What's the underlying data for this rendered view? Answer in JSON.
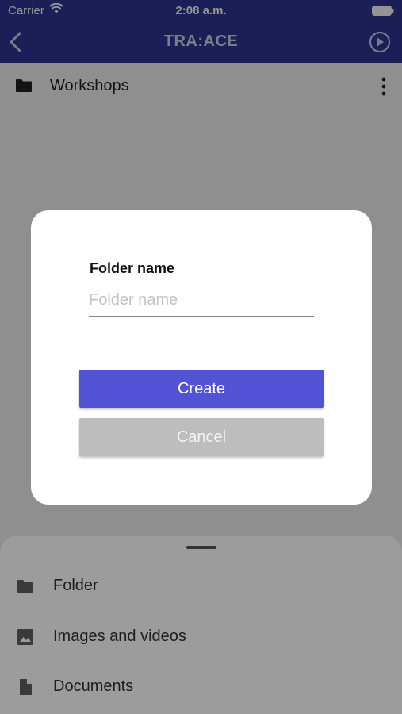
{
  "status_bar": {
    "carrier": "Carrier",
    "time": "2:08 a.m."
  },
  "nav": {
    "title": "TRA:ACE",
    "back_icon": "chevron-left-icon",
    "play_icon": "play-circle-icon"
  },
  "list": {
    "items": [
      {
        "label": "Workshops",
        "icon": "folder-icon"
      }
    ]
  },
  "dialog": {
    "field_label": "Folder name",
    "field_placeholder": "Folder name",
    "field_value": "",
    "create_label": "Create",
    "cancel_label": "Cancel"
  },
  "sheet": {
    "items": [
      {
        "label": "Folder",
        "icon": "folder-icon"
      },
      {
        "label": "Images and videos",
        "icon": "image-icon"
      },
      {
        "label": "Documents",
        "icon": "document-icon"
      }
    ]
  },
  "colors": {
    "header": "#2f3597",
    "primary_button": "#5252d4",
    "cancel_button": "#bdbdbd"
  }
}
